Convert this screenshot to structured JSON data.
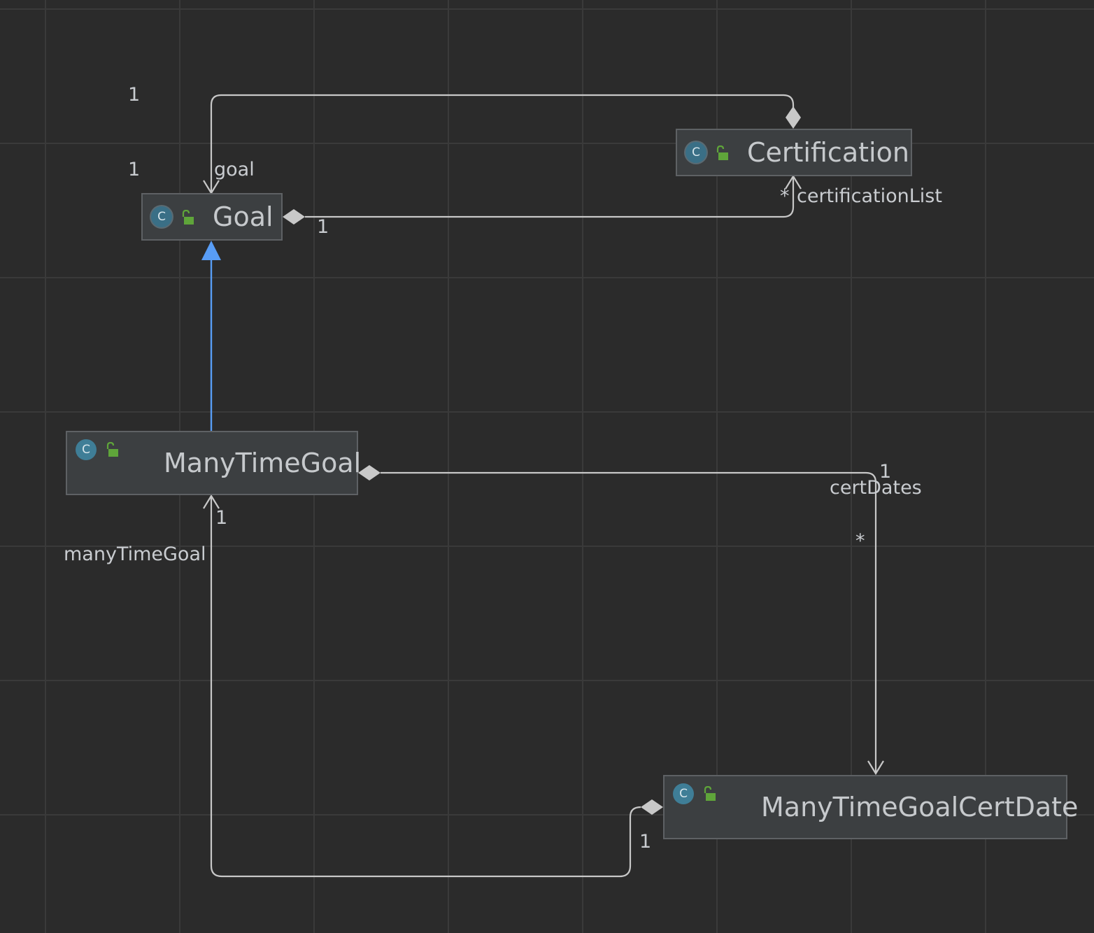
{
  "diagram": {
    "classes": {
      "certification": {
        "name": "Certification",
        "icon": "abstract-class-icon"
      },
      "goal": {
        "name": "Goal",
        "icon": "abstract-class-icon"
      },
      "many_time_goal": {
        "name": "ManyTimeGoal",
        "icon": "class-icon"
      },
      "many_time_goal_cert_date": {
        "name": "ManyTimeGoalCertDate",
        "icon": "class-icon"
      }
    },
    "icon_letter": "C",
    "colors": {
      "background": "#2b2b2b",
      "edge": "#c8c8c8",
      "inheritance": "#589df6",
      "class_icon": "#3f7e97",
      "lock": "#5fa53a"
    },
    "edges": {
      "goal_cert_top": {
        "source_mult": "1",
        "target_mult": "1",
        "role": "goal"
      },
      "goal_cert_list": {
        "source_mult": "1",
        "target_mult": "*",
        "role": "certificationList"
      },
      "mtg_cert_dates": {
        "source_mult": "1",
        "target_mult": "*",
        "role": "certDates"
      },
      "mtgcd_mtg": {
        "source_mult": "1",
        "target_mult": "1",
        "role": "manyTimeGoal"
      }
    }
  }
}
